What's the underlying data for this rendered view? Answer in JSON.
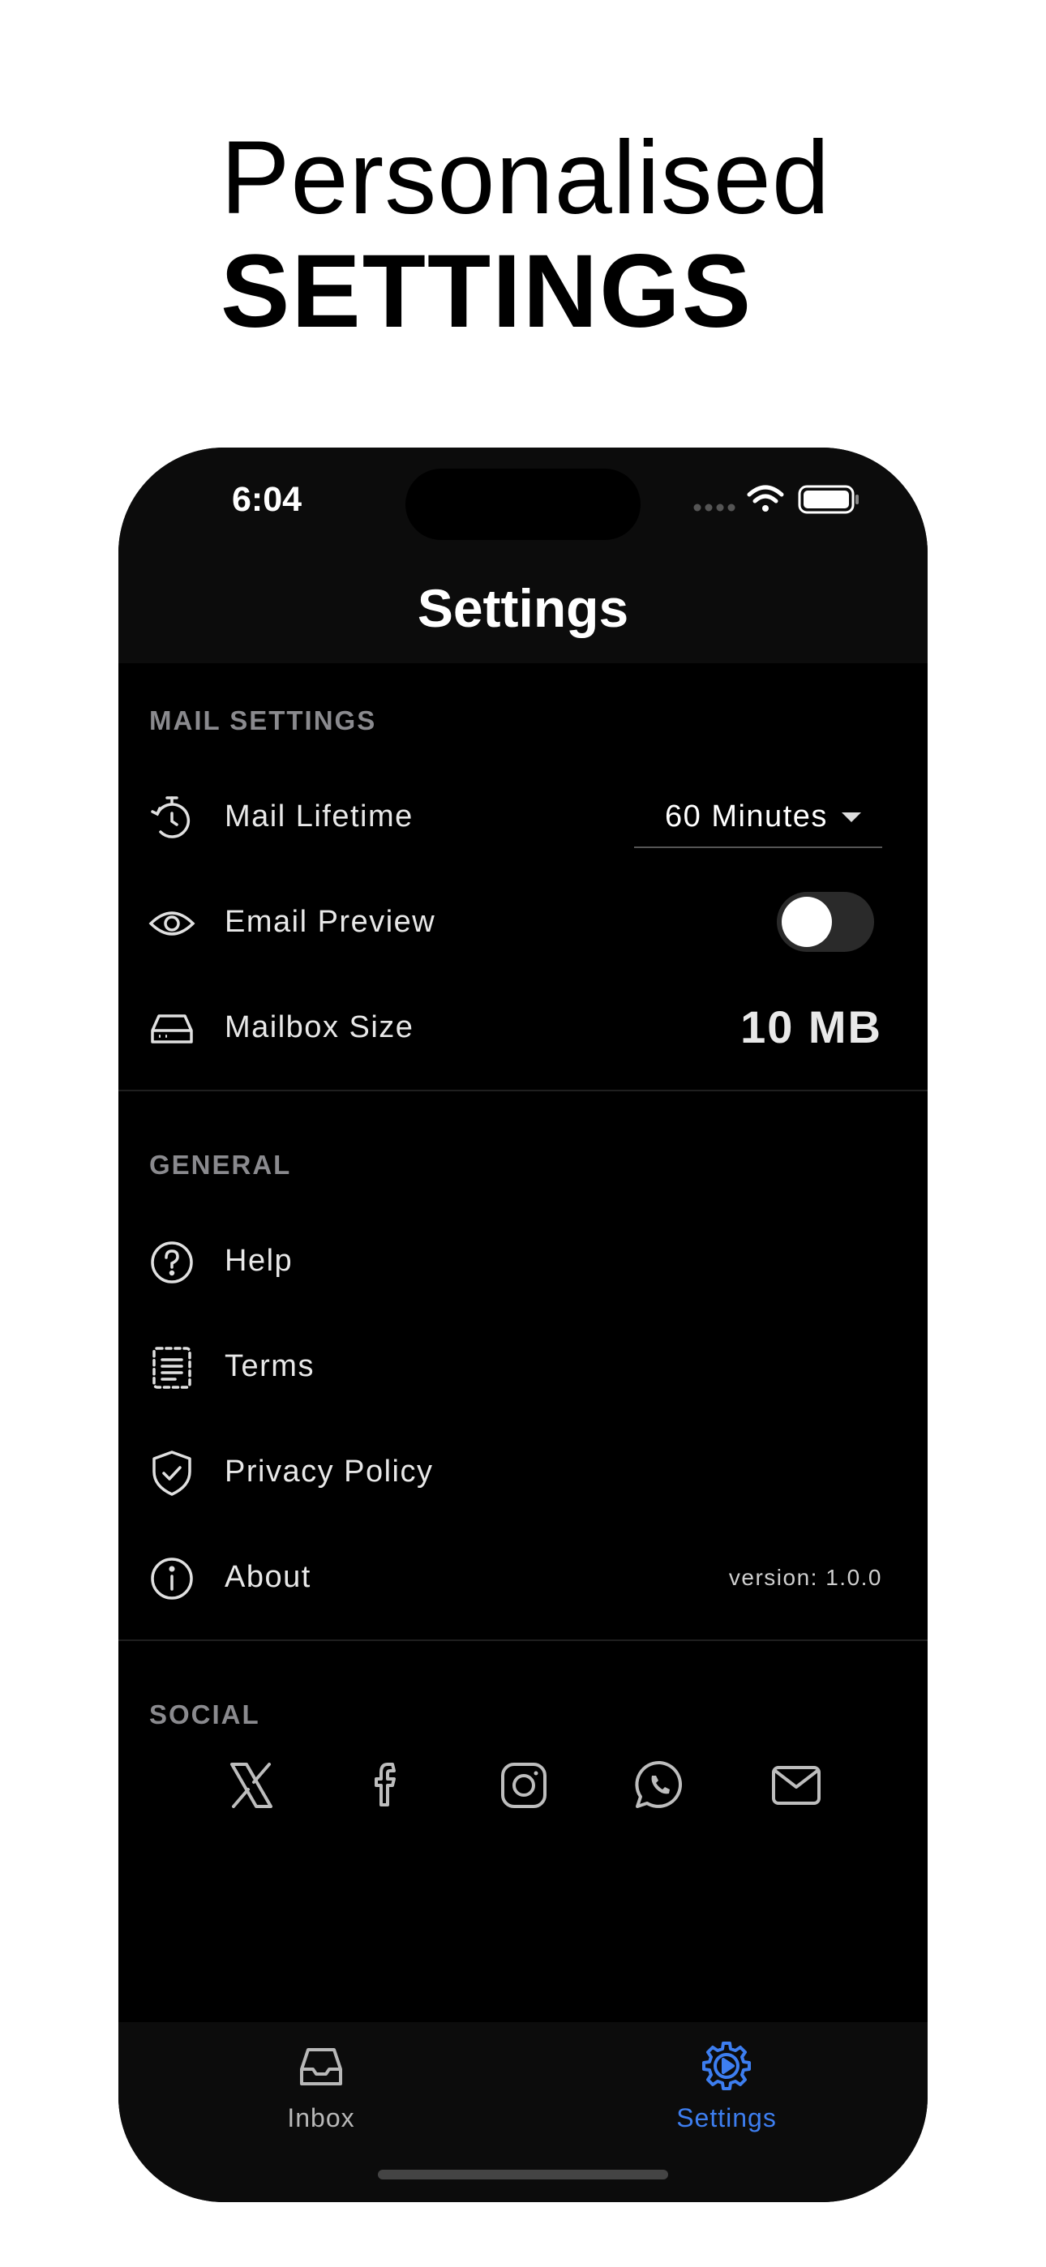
{
  "headline": {
    "line1": "Personalised",
    "line2": "SETTINGS"
  },
  "status_bar": {
    "time": "6:04"
  },
  "nav": {
    "title": "Settings"
  },
  "mail_settings": {
    "header": "MAIL SETTINGS",
    "mail_lifetime": {
      "label": "Mail Lifetime",
      "value": "60 Minutes"
    },
    "email_preview": {
      "label": "Email Preview",
      "enabled": false
    },
    "mailbox_size": {
      "label": "Mailbox Size",
      "value": "10 MB"
    }
  },
  "general": {
    "header": "GENERAL",
    "help": "Help",
    "terms": "Terms",
    "privacy": "Privacy Policy",
    "about": "About",
    "version": "version: 1.0.0"
  },
  "social": {
    "header": "SOCIAL",
    "icons": [
      "x-icon",
      "facebook-icon",
      "instagram-icon",
      "whatsapp-icon",
      "mail-icon"
    ]
  },
  "tabbar": {
    "inbox": "Inbox",
    "settings": "Settings",
    "active": "settings",
    "active_color": "#3d7ef0",
    "inactive_color": "#b8b8b8"
  }
}
